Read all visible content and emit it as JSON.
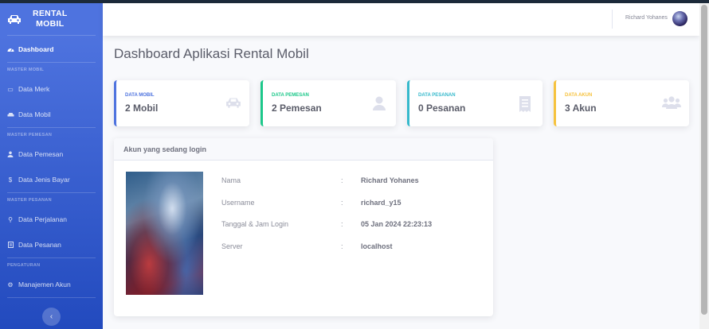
{
  "brand": {
    "line1": "RENTAL",
    "line2": "MOBIL",
    "icon": "car-icon"
  },
  "sidebar": {
    "dashboard": {
      "label": "Dashboard",
      "icon": "gauge-icon"
    },
    "sections": [
      {
        "heading": "MASTER MOBIL",
        "items": [
          {
            "label": "Data Merk",
            "icon": "id-card-icon"
          },
          {
            "label": "Data Mobil",
            "icon": "car-icon"
          }
        ]
      },
      {
        "heading": "MASTER PEMESAN",
        "items": [
          {
            "label": "Data Pemesan",
            "icon": "users-icon"
          },
          {
            "label": "Data Jenis Bayar",
            "icon": "dollar-icon"
          }
        ]
      },
      {
        "heading": "MASTER PESANAN",
        "items": [
          {
            "label": "Data Perjalanan",
            "icon": "route-icon"
          },
          {
            "label": "Data Pesanan",
            "icon": "receipt-icon"
          }
        ]
      },
      {
        "heading": "PENGATURAN",
        "items": [
          {
            "label": "Manajemen Akun",
            "icon": "gear-icon"
          }
        ]
      }
    ],
    "toggle": "‹"
  },
  "topbar": {
    "user_name": "Richard Yohanes"
  },
  "page": {
    "title": "Dashboard Aplikasi Rental Mobil"
  },
  "cards": [
    {
      "label": "DATA MOBIL",
      "value": "2 Mobil",
      "color": "#4e73df",
      "icon": "car-icon"
    },
    {
      "label": "DATA PEMESAN",
      "value": "2 Pemesan",
      "color": "#1cc88a",
      "icon": "user-icon"
    },
    {
      "label": "DATA PESANAN",
      "value": "0 Pesanan",
      "color": "#36b9cc",
      "icon": "receipt-icon"
    },
    {
      "label": "DATA AKUN",
      "value": "3 Akun",
      "color": "#f6c23e",
      "icon": "users-icon"
    }
  ],
  "login_panel": {
    "title": "Akun yang sedang login",
    "rows": [
      {
        "key": "Nama",
        "value": "Richard Yohanes"
      },
      {
        "key": "Username",
        "value": "richard_y15"
      },
      {
        "key": "Tanggal & Jam Login",
        "value": "05 Jan 2024 22:23:13"
      },
      {
        "key": "Server",
        "value": "localhost"
      }
    ],
    "separator": ":"
  }
}
